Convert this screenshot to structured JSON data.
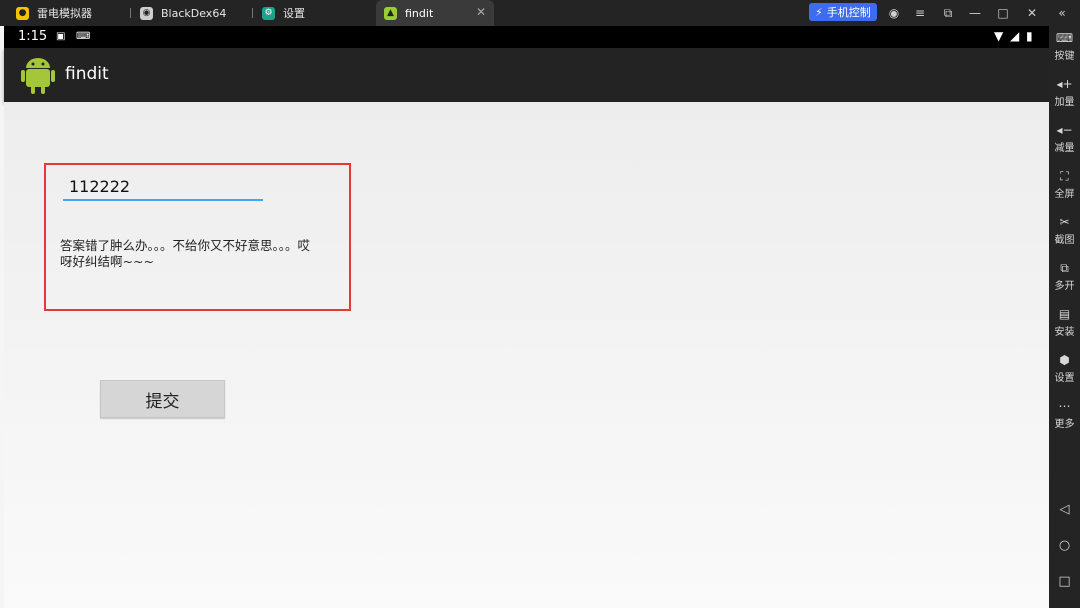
{
  "emulator": {
    "tabs": [
      {
        "label": "雷电模拟器"
      },
      {
        "label": "BlackDex64"
      },
      {
        "label": "设置"
      },
      {
        "label": "findit"
      }
    ],
    "phone_control_label": "手机控制",
    "accent_color": "#3d6cf0"
  },
  "status_bar": {
    "time": "1:15"
  },
  "app": {
    "title": "findit"
  },
  "form": {
    "answer_value": "112222",
    "message": "答案错了肿么办。。。不给你又不好意思。。。哎呀好纠结啊~~~",
    "submit_label": "提交"
  },
  "sidebar": {
    "items": [
      {
        "label": "按键",
        "icon": "keyboard-icon"
      },
      {
        "label": "加量",
        "icon": "volume-up-icon"
      },
      {
        "label": "减量",
        "icon": "volume-down-icon"
      },
      {
        "label": "全屏",
        "icon": "fullscreen-icon"
      },
      {
        "label": "截图",
        "icon": "scissors-icon"
      },
      {
        "label": "多开",
        "icon": "multi-instance-icon"
      },
      {
        "label": "安装",
        "icon": "install-icon"
      },
      {
        "label": "设置",
        "icon": "gear-icon"
      },
      {
        "label": "更多",
        "icon": "more-icon"
      }
    ]
  }
}
